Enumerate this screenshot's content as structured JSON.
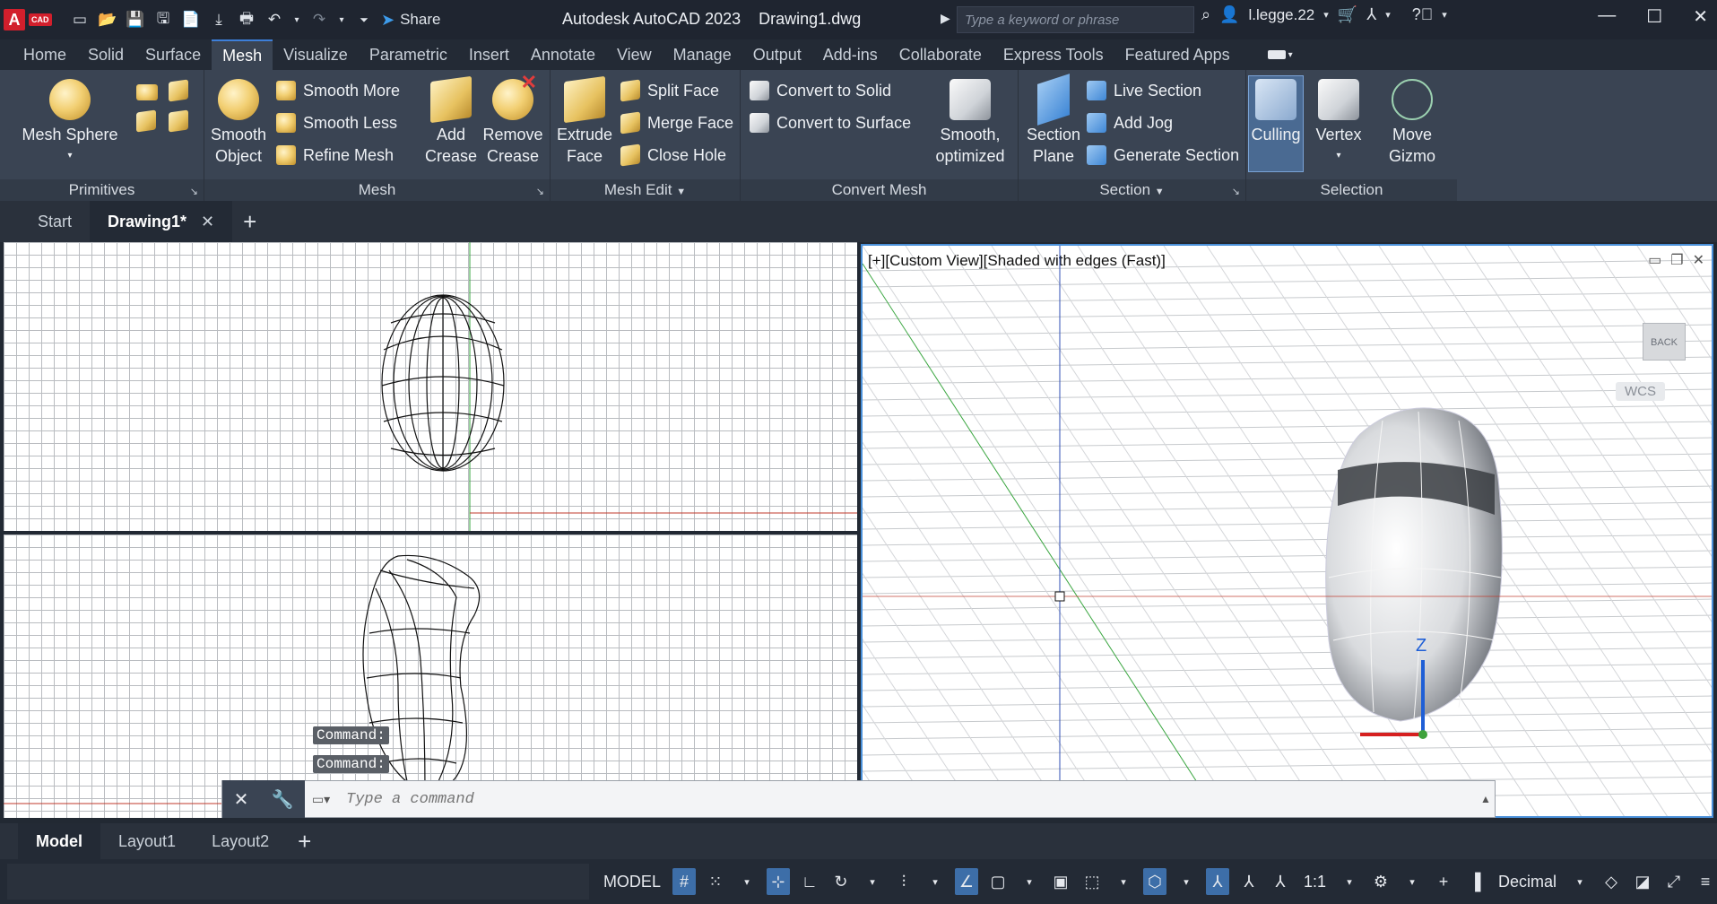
{
  "app": {
    "logo_letter": "A",
    "logo_badge": "CAD",
    "title": "Autodesk AutoCAD 2023",
    "file": "Drawing1.dwg",
    "share_label": "Share",
    "search_placeholder": "Type a keyword or phrase",
    "username": "l.legge.22"
  },
  "menu_tabs": [
    "Home",
    "Solid",
    "Surface",
    "Mesh",
    "Visualize",
    "Parametric",
    "Insert",
    "Annotate",
    "View",
    "Manage",
    "Output",
    "Add-ins",
    "Collaborate",
    "Express Tools",
    "Featured Apps"
  ],
  "active_tab": "Mesh",
  "ribbon": {
    "primitives": {
      "label": "Primitives",
      "mesh_sphere": "Mesh Sphere"
    },
    "mesh": {
      "label": "Mesh",
      "smooth_object_1": "Smooth",
      "smooth_object_2": "Object",
      "smooth_more": "Smooth More",
      "smooth_less": "Smooth Less",
      "refine_mesh": "Refine Mesh",
      "add_crease_1": "Add",
      "add_crease_2": "Crease",
      "remove_crease_1": "Remove",
      "remove_crease_2": "Crease"
    },
    "mesh_edit": {
      "label": "Mesh Edit",
      "extrude_face_1": "Extrude",
      "extrude_face_2": "Face",
      "split_face": "Split Face",
      "merge_face": "Merge Face",
      "close_hole": "Close Hole"
    },
    "convert_mesh": {
      "label": "Convert Mesh",
      "convert_solid": "Convert to Solid",
      "convert_surface": "Convert to Surface",
      "smooth_opt_1": "Smooth,",
      "smooth_opt_2": "optimized"
    },
    "section": {
      "label": "Section",
      "section_plane_1": "Section",
      "section_plane_2": "Plane",
      "live_section": "Live Section",
      "add_jog": "Add Jog",
      "generate_section": "Generate Section"
    },
    "selection": {
      "label": "Selection",
      "culling": "Culling",
      "vertex": "Vertex",
      "move_gizmo_1": "Move",
      "move_gizmo_2": "Gizmo"
    }
  },
  "doc_tabs": {
    "start": "Start",
    "drawing": "Drawing1*"
  },
  "viewport_right": {
    "label": "[+][Custom View][Shaded with edges (Fast)]",
    "viewcube_face": "BACK",
    "wcs": "WCS",
    "axis_z": "Z"
  },
  "command": {
    "history_1": "Command:",
    "history_2": "Command:",
    "placeholder": "Type a command"
  },
  "layout_tabs": [
    "Model",
    "Layout1",
    "Layout2"
  ],
  "status": {
    "model": "MODEL",
    "scale": "1:1",
    "units": "Decimal"
  }
}
